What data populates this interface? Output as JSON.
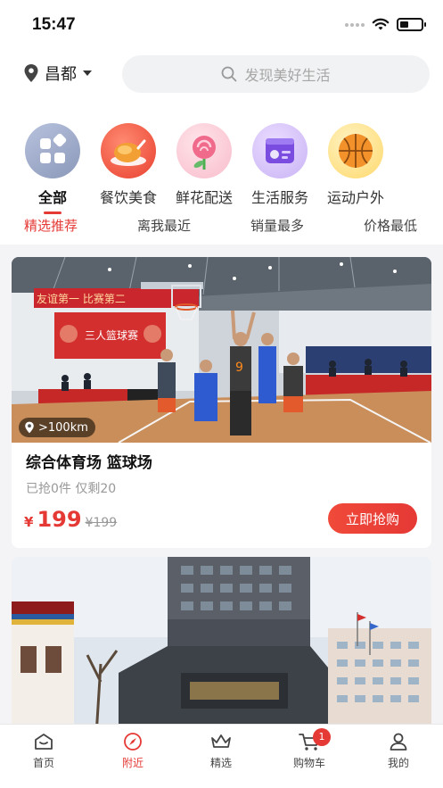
{
  "status_bar": {
    "time": "15:47"
  },
  "header": {
    "location": "昌都",
    "search_placeholder": "发现美好生活"
  },
  "categories": [
    {
      "label": "全部",
      "icon": "all-grid-icon",
      "active": true
    },
    {
      "label": "餐饮美食",
      "icon": "roast-chicken-icon"
    },
    {
      "label": "鲜花配送",
      "icon": "rose-icon"
    },
    {
      "label": "生活服务",
      "icon": "life-service-icon"
    },
    {
      "label": "运动户外",
      "icon": "basketball-icon"
    }
  ],
  "sort_tabs": [
    "精选推荐",
    "离我最近",
    "销量最多",
    "价格最低"
  ],
  "listings": [
    {
      "distance": ">100km",
      "title": "综合体育场 篮球场",
      "sold_info": "已抢0件 仅剩20",
      "currency": "¥",
      "price": "199",
      "original_price": "¥199",
      "buy_label": "立即抢购",
      "photo_banner_text": "三人篮球赛",
      "photo_wall_text": "友谊第一 比赛第二"
    },
    {
      "photo": "hotel-building"
    }
  ],
  "tab_bar": [
    {
      "label": "首页",
      "icon": "home-icon"
    },
    {
      "label": "附近",
      "icon": "nearby-compass-icon",
      "active": true
    },
    {
      "label": "精选",
      "icon": "crown-icon"
    },
    {
      "label": "购物车",
      "icon": "cart-icon",
      "badge": "1"
    },
    {
      "label": "我的",
      "icon": "user-icon"
    }
  ],
  "colors": {
    "accent": "#e53935",
    "background": "#f4f4f6"
  }
}
